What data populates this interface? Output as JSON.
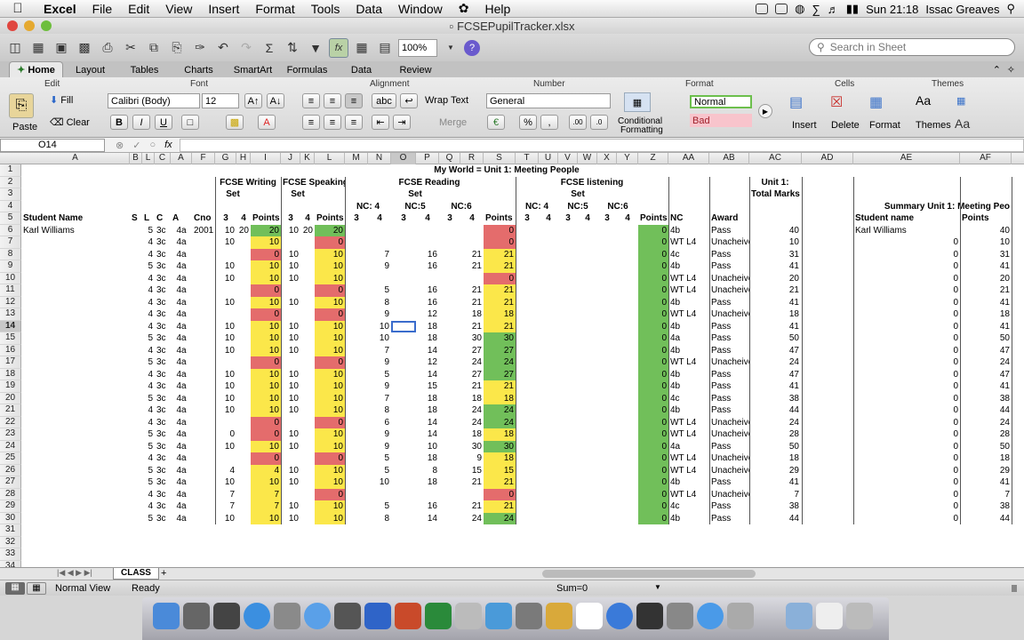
{
  "menubar": {
    "app": "Excel",
    "items": [
      "File",
      "Edit",
      "View",
      "Insert",
      "Format",
      "Tools",
      "Data",
      "Window",
      "Help"
    ],
    "clock": "Sun 21:18",
    "user": "Issac Greaves"
  },
  "window": {
    "title": "FCSEPupilTracker.xlsx"
  },
  "toolbar": {
    "zoom": "100%",
    "search_placeholder": "Search in Sheet"
  },
  "ribbon": {
    "tabs": [
      "Home",
      "Layout",
      "Tables",
      "Charts",
      "SmartArt",
      "Formulas",
      "Data",
      "Review"
    ],
    "groups": [
      "Edit",
      "Font",
      "Alignment",
      "Number",
      "Format",
      "Cells",
      "Themes"
    ],
    "paste": "Paste",
    "fill": "Fill",
    "clear": "Clear",
    "font": "Calibri (Body)",
    "size": "12",
    "bold": "B",
    "italic": "I",
    "underline": "U",
    "wrap": "Wrap Text",
    "merge": "Merge",
    "numfmt": "General",
    "percent": "%",
    "cond": "Conditional",
    "cond2": "Formatting",
    "style_normal": "Normal",
    "style_bad": "Bad",
    "insert": "Insert",
    "delete": "Delete",
    "format": "Format",
    "themes": "Themes"
  },
  "formula_bar": {
    "cell_ref": "O14",
    "fx": "fx"
  },
  "columns": [
    "A",
    "B",
    "L",
    "C",
    "A",
    "F",
    "G",
    "H",
    "I",
    "J",
    "K",
    "L",
    "M",
    "N",
    "O",
    "P",
    "Q",
    "R",
    "S",
    "T",
    "U",
    "V",
    "W",
    "X",
    "Y",
    "Z",
    "AA",
    "AB",
    "AC",
    "AD",
    "AE",
    "AF"
  ],
  "headers": {
    "title": "My World = Unit 1: Meeting People",
    "fcse_writing": "FCSE Writing",
    "fcse_speaking": "FCSE Speaking",
    "fcse_reading": "FCSE Reading",
    "fcse_listening": "FCSE listening",
    "unit_marks_1": "Unit 1:",
    "unit_marks_2": "Total Marks",
    "set": "Set",
    "nc4": "NC: 4",
    "nc5": "NC:5",
    "nc6": "NC:6",
    "student_name": "Student Name",
    "s": "S",
    "l": "L",
    "c": "C",
    "a": "A",
    "cno": "Cno",
    "three": "3",
    "four": "4",
    "points": "Points",
    "nc": "NC",
    "award": "Award",
    "summary": "Summary Unit 1: Meeting Peo",
    "sum_student": "Student name",
    "sum_points": "Points"
  },
  "rows": [
    {
      "name": "Karl Williams",
      "l": "5",
      "c": "3c",
      "a": "4a",
      "cno": "2001",
      "g": "10",
      "h": "20",
      "i": "20",
      "j": "10",
      "k": "20",
      "l2": "20",
      "o": "",
      "p": "",
      "r": "",
      "s": "0",
      "z": "0",
      "aa": "4b",
      "ab": "Pass",
      "ac": "40",
      "ae": "Karl Williams",
      "af": "40",
      "aeval": ""
    },
    {
      "name": "",
      "l": "4",
      "c": "3c",
      "a": "4a",
      "cno": "",
      "g": "10",
      "h": "",
      "i": "10",
      "j": "",
      "k": "",
      "l2": "0",
      "o": "",
      "p": "",
      "r": "",
      "s": "0",
      "z": "0",
      "aa": "WT L4",
      "ab": "Unacheive",
      "ac": "10",
      "aeval": "0",
      "af": "10"
    },
    {
      "name": "",
      "l": "4",
      "c": "3c",
      "a": "4a",
      "cno": "",
      "g": "",
      "h": "",
      "i": "0",
      "j": "10",
      "k": "",
      "l2": "10",
      "o": "7",
      "p": "16",
      "r": "21",
      "s": "21",
      "z": "0",
      "aa": "4c",
      "ab": "Pass",
      "ac": "31",
      "aeval": "0",
      "af": "31"
    },
    {
      "name": "",
      "l": "5",
      "c": "3c",
      "a": "4a",
      "cno": "",
      "g": "10",
      "h": "",
      "i": "10",
      "j": "10",
      "k": "",
      "l2": "10",
      "o": "9",
      "p": "16",
      "r": "21",
      "s": "21",
      "z": "0",
      "aa": "4b",
      "ab": "Pass",
      "ac": "41",
      "aeval": "0",
      "af": "41"
    },
    {
      "name": "",
      "l": "4",
      "c": "3c",
      "a": "4a",
      "cno": "",
      "g": "10",
      "h": "",
      "i": "10",
      "j": "10",
      "k": "",
      "l2": "10",
      "o": "",
      "p": "",
      "r": "",
      "s": "0",
      "z": "0",
      "aa": "WT L4",
      "ab": "Unacheive",
      "ac": "20",
      "aeval": "0",
      "af": "20"
    },
    {
      "name": "",
      "l": "4",
      "c": "3c",
      "a": "4a",
      "cno": "",
      "g": "",
      "h": "",
      "i": "0",
      "j": "",
      "k": "",
      "l2": "0",
      "o": "5",
      "p": "16",
      "r": "21",
      "s": "21",
      "z": "0",
      "aa": "WT L4",
      "ab": "Unacheive",
      "ac": "21",
      "aeval": "0",
      "af": "21"
    },
    {
      "name": "",
      "l": "4",
      "c": "3c",
      "a": "4a",
      "cno": "",
      "g": "10",
      "h": "",
      "i": "10",
      "j": "10",
      "k": "",
      "l2": "10",
      "o": "8",
      "p": "16",
      "r": "21",
      "s": "21",
      "z": "0",
      "aa": "4b",
      "ab": "Pass",
      "ac": "41",
      "aeval": "0",
      "af": "41"
    },
    {
      "name": "",
      "l": "4",
      "c": "3c",
      "a": "4a",
      "cno": "",
      "g": "",
      "h": "",
      "i": "0",
      "j": "",
      "k": "",
      "l2": "0",
      "o": "9",
      "p": "12",
      "r": "18",
      "s": "18",
      "z": "0",
      "aa": "WT L4",
      "ab": "Unacheive",
      "ac": "18",
      "aeval": "0",
      "af": "18"
    },
    {
      "name": "",
      "l": "4",
      "c": "3c",
      "a": "4a",
      "cno": "",
      "g": "10",
      "h": "",
      "i": "10",
      "j": "10",
      "k": "",
      "l2": "10",
      "o": "10",
      "p": "18",
      "r": "21",
      "s": "21",
      "z": "0",
      "aa": "4b",
      "ab": "Pass",
      "ac": "41",
      "aeval": "0",
      "af": "41"
    },
    {
      "name": "",
      "l": "5",
      "c": "3c",
      "a": "4a",
      "cno": "",
      "g": "10",
      "h": "",
      "i": "10",
      "j": "10",
      "k": "",
      "l2": "10",
      "o": "10",
      "p": "18",
      "r": "30",
      "s": "30",
      "z": "0",
      "aa": "4a",
      "ab": "Pass",
      "ac": "50",
      "aeval": "0",
      "af": "50"
    },
    {
      "name": "",
      "l": "4",
      "c": "3c",
      "a": "4a",
      "cno": "",
      "g": "10",
      "h": "",
      "i": "10",
      "j": "10",
      "k": "",
      "l2": "10",
      "o": "7",
      "p": "14",
      "r": "27",
      "s": "27",
      "z": "0",
      "aa": "4b",
      "ab": "Pass",
      "ac": "47",
      "aeval": "0",
      "af": "47"
    },
    {
      "name": "",
      "l": "5",
      "c": "3c",
      "a": "4a",
      "cno": "",
      "g": "",
      "h": "",
      "i": "0",
      "j": "",
      "k": "",
      "l2": "0",
      "o": "9",
      "p": "12",
      "r": "24",
      "s": "24",
      "z": "0",
      "aa": "WT L4",
      "ab": "Unacheive",
      "ac": "24",
      "aeval": "0",
      "af": "24"
    },
    {
      "name": "",
      "l": "4",
      "c": "3c",
      "a": "4a",
      "cno": "",
      "g": "10",
      "h": "",
      "i": "10",
      "j": "10",
      "k": "",
      "l2": "10",
      "o": "5",
      "p": "14",
      "r": "27",
      "s": "27",
      "z": "0",
      "aa": "4b",
      "ab": "Pass",
      "ac": "47",
      "aeval": "0",
      "af": "47"
    },
    {
      "name": "",
      "l": "4",
      "c": "3c",
      "a": "4a",
      "cno": "",
      "g": "10",
      "h": "",
      "i": "10",
      "j": "10",
      "k": "",
      "l2": "10",
      "o": "9",
      "p": "15",
      "r": "21",
      "s": "21",
      "z": "0",
      "aa": "4b",
      "ab": "Pass",
      "ac": "41",
      "aeval": "0",
      "af": "41"
    },
    {
      "name": "",
      "l": "5",
      "c": "3c",
      "a": "4a",
      "cno": "",
      "g": "10",
      "h": "",
      "i": "10",
      "j": "10",
      "k": "",
      "l2": "10",
      "o": "7",
      "p": "18",
      "r": "18",
      "s": "18",
      "z": "0",
      "aa": "4c",
      "ab": "Pass",
      "ac": "38",
      "aeval": "0",
      "af": "38"
    },
    {
      "name": "",
      "l": "4",
      "c": "3c",
      "a": "4a",
      "cno": "",
      "g": "10",
      "h": "",
      "i": "10",
      "j": "10",
      "k": "",
      "l2": "10",
      "o": "8",
      "p": "18",
      "r": "24",
      "s": "24",
      "z": "0",
      "aa": "4b",
      "ab": "Pass",
      "ac": "44",
      "aeval": "0",
      "af": "44"
    },
    {
      "name": "",
      "l": "4",
      "c": "3c",
      "a": "4a",
      "cno": "",
      "g": "",
      "h": "",
      "i": "0",
      "j": "",
      "k": "",
      "l2": "0",
      "o": "6",
      "p": "14",
      "r": "24",
      "s": "24",
      "z": "0",
      "aa": "WT L4",
      "ab": "Unacheive",
      "ac": "24",
      "aeval": "0",
      "af": "24"
    },
    {
      "name": "",
      "l": "5",
      "c": "3c",
      "a": "4a",
      "cno": "",
      "g": "0",
      "h": "",
      "i": "0",
      "j": "10",
      "k": "",
      "l2": "10",
      "o": "9",
      "p": "14",
      "r": "18",
      "s": "18",
      "z": "0",
      "aa": "WT L4",
      "ab": "Unacheive",
      "ac": "28",
      "aeval": "0",
      "af": "28"
    },
    {
      "name": "",
      "l": "5",
      "c": "3c",
      "a": "4a",
      "cno": "",
      "g": "10",
      "h": "",
      "i": "10",
      "j": "10",
      "k": "",
      "l2": "10",
      "o": "9",
      "p": "10",
      "r": "30",
      "s": "30",
      "z": "0",
      "aa": "4a",
      "ab": "Pass",
      "ac": "50",
      "aeval": "0",
      "af": "50"
    },
    {
      "name": "",
      "l": "4",
      "c": "3c",
      "a": "4a",
      "cno": "",
      "g": "",
      "h": "",
      "i": "0",
      "j": "",
      "k": "",
      "l2": "0",
      "o": "5",
      "p": "18",
      "r": "9",
      "s": "18",
      "z": "0",
      "aa": "WT L4",
      "ab": "Unacheive",
      "ac": "18",
      "aeval": "0",
      "af": "18"
    },
    {
      "name": "",
      "l": "5",
      "c": "3c",
      "a": "4a",
      "cno": "",
      "g": "4",
      "h": "",
      "i": "4",
      "j": "10",
      "k": "",
      "l2": "10",
      "o": "5",
      "p": "8",
      "r": "15",
      "s": "15",
      "z": "0",
      "aa": "WT L4",
      "ab": "Unacheive",
      "ac": "29",
      "aeval": "0",
      "af": "29"
    },
    {
      "name": "",
      "l": "5",
      "c": "3c",
      "a": "4a",
      "cno": "",
      "g": "10",
      "h": "",
      "i": "10",
      "j": "10",
      "k": "",
      "l2": "10",
      "o": "10",
      "p": "18",
      "r": "21",
      "s": "21",
      "z": "0",
      "aa": "4b",
      "ab": "Pass",
      "ac": "41",
      "aeval": "0",
      "af": "41"
    },
    {
      "name": "",
      "l": "4",
      "c": "3c",
      "a": "4a",
      "cno": "",
      "g": "7",
      "h": "",
      "i": "7",
      "j": "",
      "k": "",
      "l2": "0",
      "o": "",
      "p": "",
      "r": "",
      "s": "0",
      "z": "0",
      "aa": "WT L4",
      "ab": "Unacheive",
      "ac": "7",
      "aeval": "0",
      "af": "7"
    },
    {
      "name": "",
      "l": "4",
      "c": "3c",
      "a": "4a",
      "cno": "",
      "g": "7",
      "h": "",
      "i": "7",
      "j": "10",
      "k": "",
      "l2": "10",
      "o": "5",
      "p": "16",
      "r": "21",
      "s": "21",
      "z": "0",
      "aa": "4c",
      "ab": "Pass",
      "ac": "38",
      "aeval": "0",
      "af": "38"
    },
    {
      "name": "",
      "l": "5",
      "c": "3c",
      "a": "4a",
      "cno": "",
      "g": "10",
      "h": "",
      "i": "10",
      "j": "10",
      "k": "",
      "l2": "10",
      "o": "8",
      "p": "14",
      "r": "24",
      "s": "24",
      "z": "0",
      "aa": "4b",
      "ab": "Pass",
      "ac": "44",
      "aeval": "0",
      "af": "44"
    }
  ],
  "sheet_tab": "CLASS",
  "status": {
    "view": "Normal View",
    "ready": "Ready",
    "sum": "Sum=0"
  }
}
